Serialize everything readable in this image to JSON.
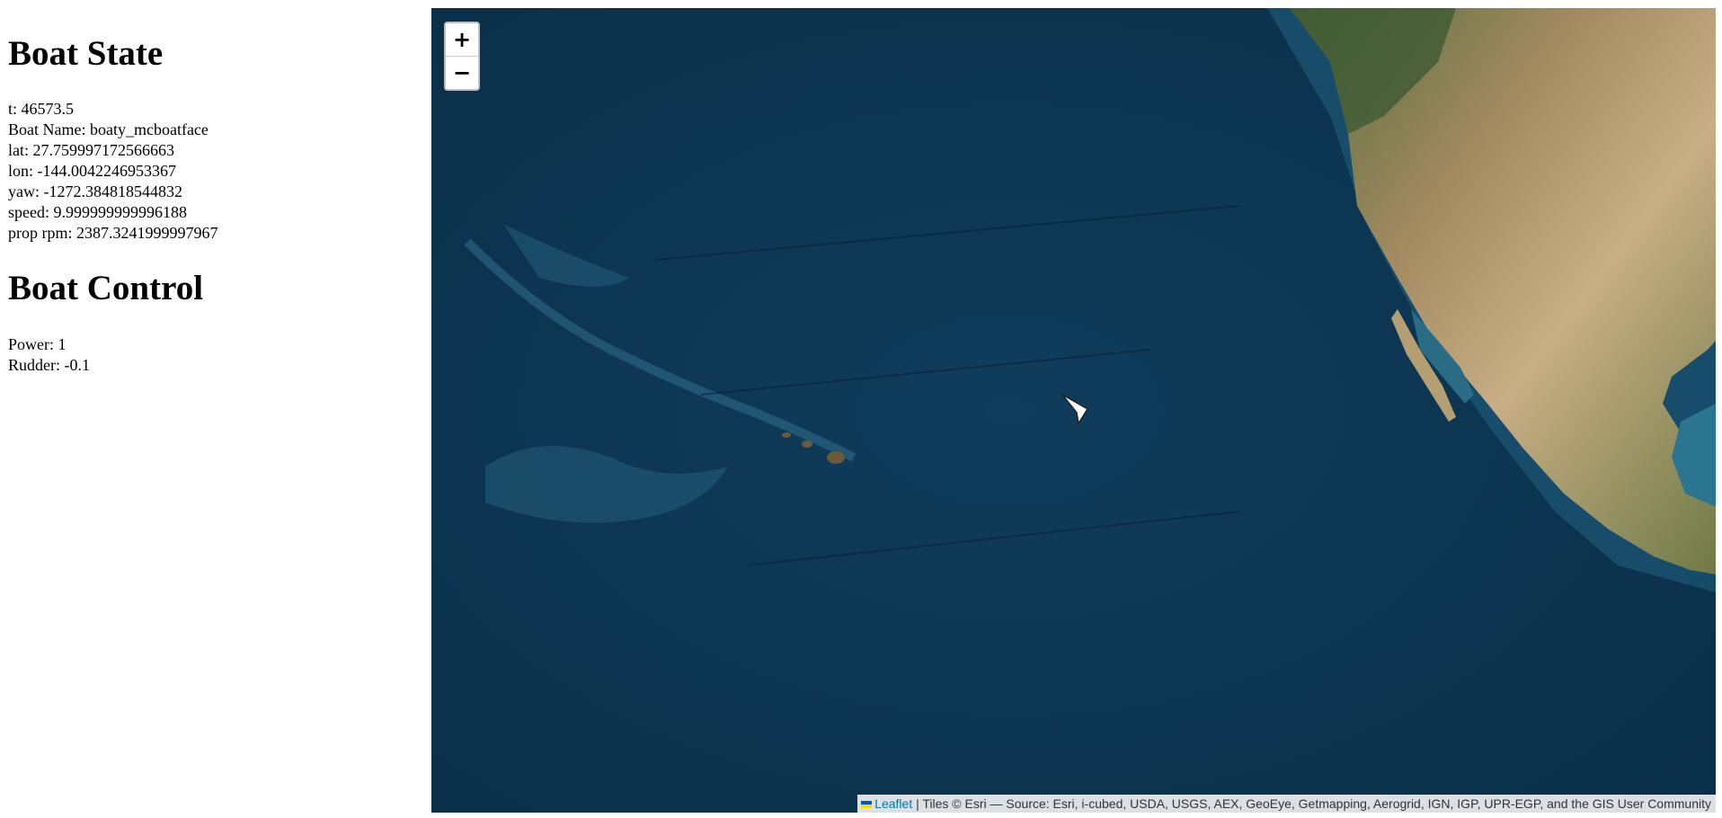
{
  "boat_state": {
    "title": "Boat State",
    "t": "t: 46573.5",
    "boat_name": "Boat Name: boaty_mcboatface",
    "lat": "lat: 27.759997172566663",
    "lon": "lon: -144.0042246953367",
    "yaw": "yaw: -1272.384818544832",
    "speed": "speed: 9.999999999996188",
    "prop_rpm": "prop rpm: 2387.3241999997967"
  },
  "boat_control": {
    "title": "Boat Control",
    "power": "Power: 1",
    "rudder": "Rudder: -0.1"
  },
  "map": {
    "zoom_in_label": "+",
    "zoom_out_label": "−",
    "marker_icon": "boat-arrow-icon",
    "attribution": {
      "leaflet_link": "Leaflet",
      "text": " | Tiles © Esri — Source: Esri, i-cubed, USDA, USGS, AEX, GeoEye, Getmapping, Aerogrid, IGN, IGP, UPR-EGP, and the GIS User Community"
    },
    "colors": {
      "ocean": "#0c3550",
      "land": "#b89a6e",
      "forest": "#5a6b3a"
    }
  }
}
